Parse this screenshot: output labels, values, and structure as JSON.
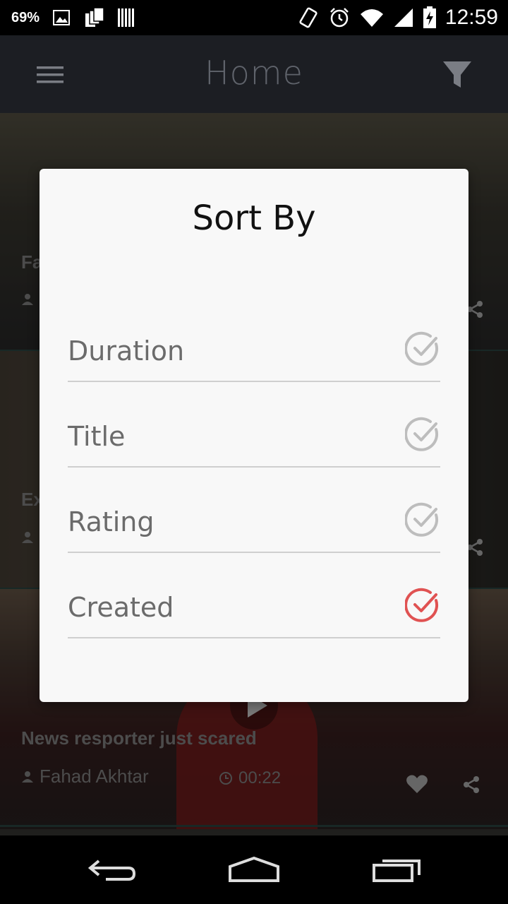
{
  "status_bar": {
    "battery_percent": "69%",
    "time": "12:59",
    "icons": [
      "image-icon",
      "sim-cards-icon",
      "barcode-icon",
      "vibrate-icon",
      "alarm-icon",
      "wifi-icon",
      "signal-icon",
      "battery-charging-icon"
    ]
  },
  "app_bar": {
    "title": "Home",
    "menu_icon": "hamburger-menu-icon",
    "filter_icon": "filter-icon"
  },
  "feed": {
    "cards": [
      {
        "title": "Fa",
        "author": "",
        "duration": ""
      },
      {
        "title": "Ex",
        "author": "",
        "duration": ""
      },
      {
        "title": "News resporter just scared",
        "author": "Fahad Akhtar",
        "duration": "00:22"
      }
    ]
  },
  "dialog": {
    "title": "Sort By",
    "options": [
      {
        "label": "Duration",
        "selected": false
      },
      {
        "label": "Title",
        "selected": false
      },
      {
        "label": "Rating",
        "selected": false
      },
      {
        "label": "Created",
        "selected": true
      }
    ],
    "colors": {
      "selected": "#e05252",
      "unselected": "#bdbdbd"
    }
  },
  "nav_bar": {
    "icons": [
      "back-icon",
      "home-icon",
      "recents-icon"
    ]
  }
}
